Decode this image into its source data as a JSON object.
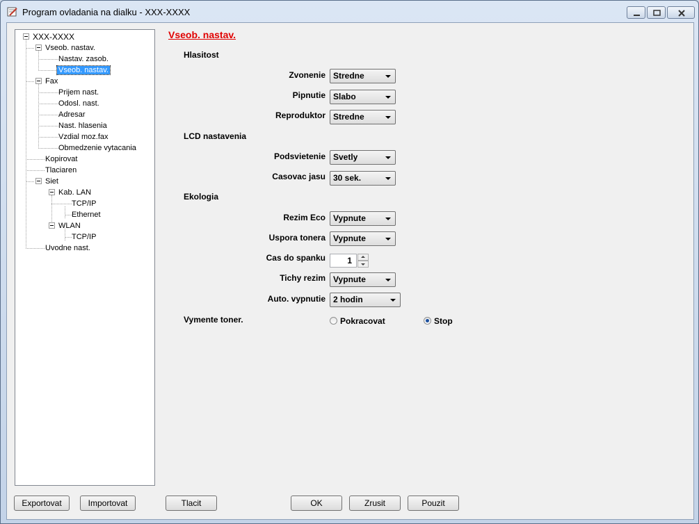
{
  "window": {
    "title": "Program ovladania na dialku -  XXX-XXXX"
  },
  "tree": {
    "root": "XXX-XXXX",
    "items": [
      {
        "label": "Vseob. nastav."
      },
      {
        "label": "Nastav. zasob."
      },
      {
        "label": "Vseob. nastav.",
        "selected": true
      },
      {
        "label": "Fax"
      },
      {
        "label": "Prijem nast."
      },
      {
        "label": "Odosl. nast."
      },
      {
        "label": "Adresar"
      },
      {
        "label": "Nast. hlasenia"
      },
      {
        "label": "Vzdial moz.fax"
      },
      {
        "label": "Obmedzenie vytacania"
      },
      {
        "label": "Kopirovat"
      },
      {
        "label": "Tlaciaren"
      },
      {
        "label": "Siet"
      },
      {
        "label": "Kab. LAN"
      },
      {
        "label": "TCP/IP"
      },
      {
        "label": "Ethernet"
      },
      {
        "label": "WLAN"
      },
      {
        "label": "TCP/IP"
      },
      {
        "label": "Uvodne nast."
      }
    ]
  },
  "panel": {
    "title": "Vseob. nastav.",
    "groups": {
      "volume": "Hlasitost",
      "lcd": "LCD nastavenia",
      "ecology": "Ekologia"
    },
    "fields": {
      "ring": {
        "label": "Zvonenie",
        "value": "Stredne"
      },
      "beep": {
        "label": "Pipnutie",
        "value": "Slabo"
      },
      "speaker": {
        "label": "Reproduktor",
        "value": "Stredne"
      },
      "backlight": {
        "label": "Podsvietenie",
        "value": "Svetly"
      },
      "dim_timer": {
        "label": "Casovac jasu",
        "value": "30 sek."
      },
      "eco_mode": {
        "label": "Rezim Eco",
        "value": "Vypnute"
      },
      "toner_save": {
        "label": "Uspora tonera",
        "value": "Vypnute"
      },
      "sleep_time": {
        "label": "Cas do spanku",
        "value": "1"
      },
      "quiet_mode": {
        "label": "Tichy rezim",
        "value": "Vypnute"
      },
      "auto_off": {
        "label": "Auto. vypnutie",
        "value": "2 hodin"
      }
    },
    "replace_toner": {
      "label": "Vymente toner.",
      "options": [
        {
          "label": "Pokracovat",
          "checked": false
        },
        {
          "label": "Stop",
          "checked": true
        }
      ]
    }
  },
  "buttons": {
    "export": "Exportovat",
    "import": "Importovat",
    "print": "Tlacit",
    "ok": "OK",
    "cancel": "Zrusit",
    "apply": "Pouzit"
  },
  "colors": {
    "section_title": "#e00000",
    "selection": "#3399ff"
  }
}
